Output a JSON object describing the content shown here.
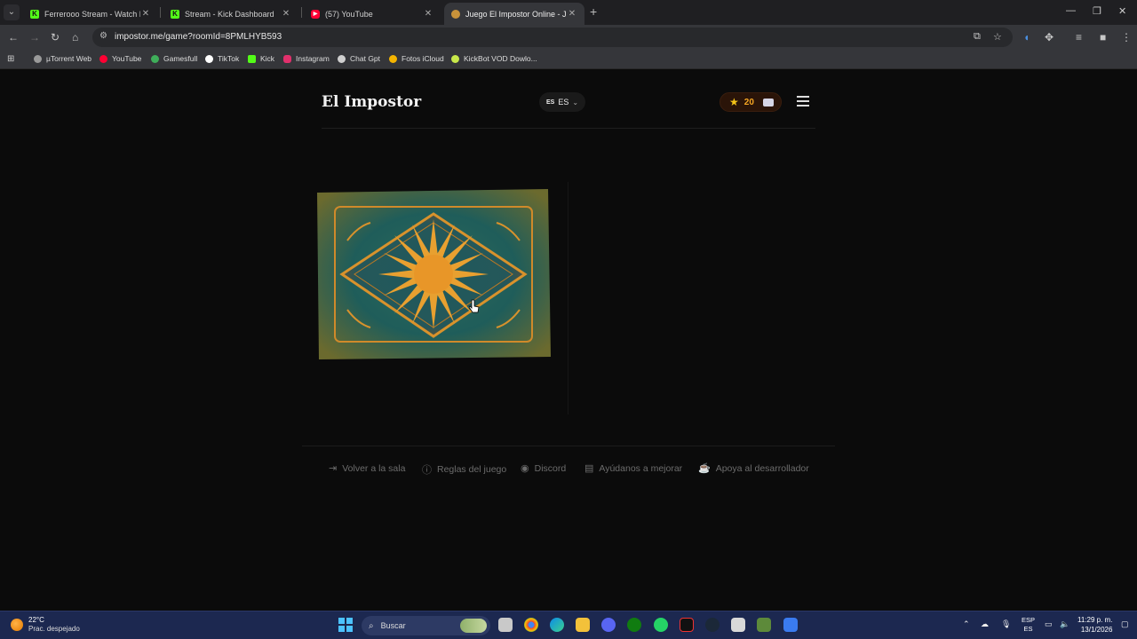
{
  "browser": {
    "tabs": [
      {
        "title": "Ferrerooo Stream - Watch Live",
        "favicon": "kick-icon",
        "color": "#53fc18"
      },
      {
        "title": "Stream - Kick Dashboard",
        "favicon": "kick-icon",
        "color": "#53fc18"
      },
      {
        "title": "(57) YouTube",
        "favicon": "youtube-icon",
        "color": "#ff0033"
      },
      {
        "title": "Juego El Impostor Online - Jug",
        "favicon": "impostor-icon",
        "color": "#c8923a"
      }
    ],
    "url": "impostor.me/game?roomId=8PMLHYB593",
    "bookmarks": [
      {
        "label": "µTorrent Web",
        "color": "#9a9a9a"
      },
      {
        "label": "YouTube",
        "color": "#ff0033"
      },
      {
        "label": "Gamesfull",
        "color": "#3fae5a"
      },
      {
        "label": "TikTok",
        "color": "#ffffff"
      },
      {
        "label": "Kick",
        "color": "#53fc18"
      },
      {
        "label": "Instagram",
        "color": "#e1306c"
      },
      {
        "label": "Chat Gpt",
        "color": "#cfcfcf"
      },
      {
        "label": "Fotos iCloud",
        "color": "#f4b400"
      },
      {
        "label": "KickBot VOD Dowlo...",
        "color": "#c8e84a"
      }
    ]
  },
  "app": {
    "logo": "El Impostor",
    "language": {
      "flag": "ES",
      "code": "ES"
    },
    "score": "20",
    "footer_links": [
      {
        "label": "Volver a la sala",
        "icon": "exit-icon"
      },
      {
        "label": "Reglas del juego",
        "icon": "info-icon"
      },
      {
        "label": "Discord",
        "icon": "discord-icon"
      },
      {
        "label": "Ayúdanos a mejorar",
        "icon": "feedback-icon"
      },
      {
        "label": "Apoya al desarrollador",
        "icon": "coffee-icon"
      }
    ]
  },
  "taskbar": {
    "weather_temp": "22°C",
    "weather_desc": "Prac. despejado",
    "search_placeholder": "Buscar",
    "lang_top": "ESP",
    "lang_bottom": "ES",
    "time": "11:29 p. m.",
    "date": "13/1/2026"
  }
}
